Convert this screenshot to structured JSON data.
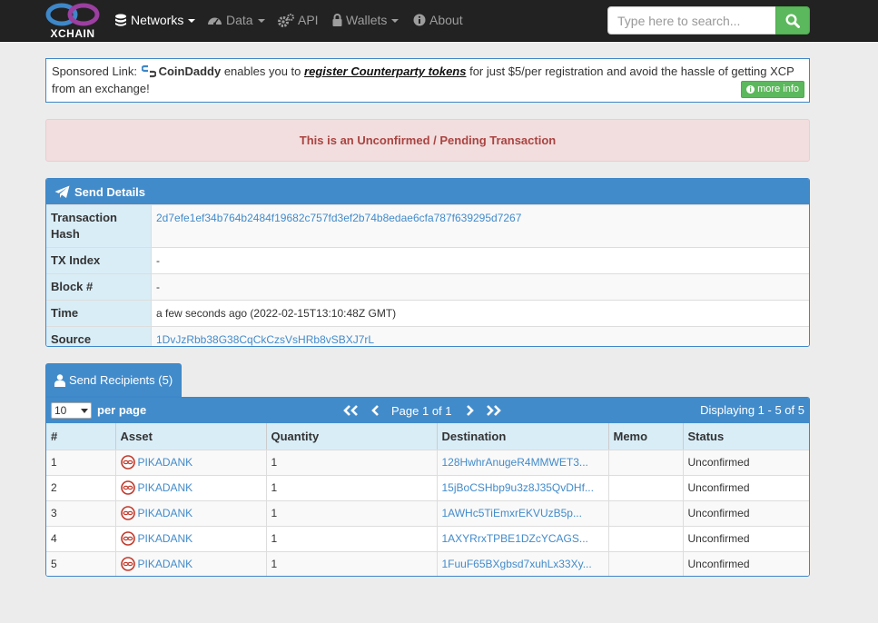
{
  "brand": {
    "name": "XCHAIN",
    "primary_color": "#428bca",
    "logo_colors": [
      "#3e87c8",
      "#9b3fa0"
    ]
  },
  "nav": {
    "networks": {
      "label": "Networks",
      "icon": "database-icon"
    },
    "data": {
      "label": "Data",
      "icon": "dashboard-icon"
    },
    "api": {
      "label": "API",
      "icon": "cogs-icon"
    },
    "wallets": {
      "label": "Wallets",
      "icon": "lock-icon"
    },
    "about": {
      "label": "About",
      "icon": "info-icon"
    }
  },
  "search": {
    "placeholder": "Type here to search...",
    "value": ""
  },
  "sponsored": {
    "prefix": "Sponsored Link:",
    "brand": "CoinDaddy",
    "text1": "enables you to",
    "link": "register Counterparty tokens",
    "text2": "for just $5/per registration and avoid the hassle of getting XCP from an exchange!",
    "more_info": "more info"
  },
  "alert": {
    "text": "This is an Unconfirmed / Pending Transaction"
  },
  "send_details": {
    "title": "Send Details",
    "rows": [
      {
        "label": "Transaction Hash",
        "value": "2d7efe1ef34b764b2484f19682c757fd3ef2b74b8edae6cfa787f639295d7267"
      },
      {
        "label": "TX Index",
        "value": "-"
      },
      {
        "label": "Block #",
        "value": "-"
      },
      {
        "label": "Time",
        "value": "a few seconds ago (2022-02-15T13:10:48Z GMT)"
      },
      {
        "label": "Source",
        "value": "1DvJzRbb38G38CqCkCzsVsHRb8vSBXJ7rL"
      }
    ]
  },
  "recipients": {
    "tab_label": "Send Recipients (5)",
    "per_page_value": "10",
    "per_page_label": "per page",
    "page_text": "Page 1 of 1",
    "displaying": "Displaying 1 - 5 of 5",
    "columns": [
      "#",
      "Asset",
      "Quantity",
      "Destination",
      "Memo",
      "Status"
    ],
    "rows": [
      {
        "num": "1",
        "asset": "PIKADANK",
        "quantity": "1",
        "destination": "128HwhrAnugeR4MMWET3...",
        "memo": "",
        "status": "Unconfirmed"
      },
      {
        "num": "2",
        "asset": "PIKADANK",
        "quantity": "1",
        "destination": "15jBoCSHbp9u3z8J35QvDHf...",
        "memo": "",
        "status": "Unconfirmed"
      },
      {
        "num": "3",
        "asset": "PIKADANK",
        "quantity": "1",
        "destination": "1AWHc5TiEmxrEKVUzB5p...",
        "memo": "",
        "status": "Unconfirmed"
      },
      {
        "num": "4",
        "asset": "PIKADANK",
        "quantity": "1",
        "destination": "1AXYRrxTPBE1DZcYCAGS...",
        "memo": "",
        "status": "Unconfirmed"
      },
      {
        "num": "5",
        "asset": "PIKADANK",
        "quantity": "1",
        "destination": "1FuuF65BXgbsd7xuhLx33Xy...",
        "memo": "",
        "status": "Unconfirmed"
      }
    ]
  }
}
